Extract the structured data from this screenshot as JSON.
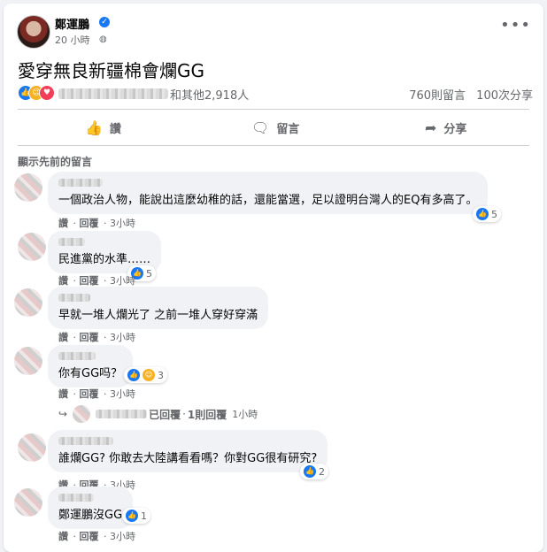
{
  "post": {
    "author": "鄭運鵬",
    "time": "20 小時",
    "text": "愛穿無良新疆棉會爛GG",
    "reactions_others": "和其他2,918人",
    "comments_count": "760則留言",
    "shares_count": "100次分享"
  },
  "actions": {
    "like": "讚",
    "comment": "留言",
    "share": "分享"
  },
  "previous_comments_label": "顯示先前的留言",
  "comments": [
    {
      "text": "一個政治人物，能說出這麼幼稚的話，還能當選，足以證明台灣人的EQ有多高了。",
      "reaction_count": "5",
      "like": "讚",
      "reply": "回覆",
      "time": "3小時"
    },
    {
      "text": "民進黨的水準……",
      "reaction_count": "5",
      "like": "讚",
      "reply": "回覆",
      "time": "3小時"
    },
    {
      "text": "早就一堆人爛光了 之前一堆人穿好穿滿",
      "like": "讚",
      "reply": "回覆",
      "time": "3小時"
    },
    {
      "text": "你有GG吗？",
      "reaction_count": "3",
      "like": "讚",
      "reply": "回覆",
      "time": "3小時",
      "reply_summary": {
        "replied": "已回覆",
        "count": "1則回覆",
        "time": "1小時"
      }
    },
    {
      "text": "誰爛GG? 你敢去大陸講看看嗎？你對GG很有研究?",
      "reaction_count": "2",
      "like": "讚",
      "reply": "回覆",
      "time": "3小時"
    },
    {
      "text": "鄭運鵬沒GG",
      "reaction_count": "1",
      "like": "讚",
      "reply": "回覆",
      "time": "3小時"
    }
  ],
  "colors": {
    "accent": "#1877f2",
    "muted": "#65676b",
    "bubble": "#f0f2f5"
  }
}
